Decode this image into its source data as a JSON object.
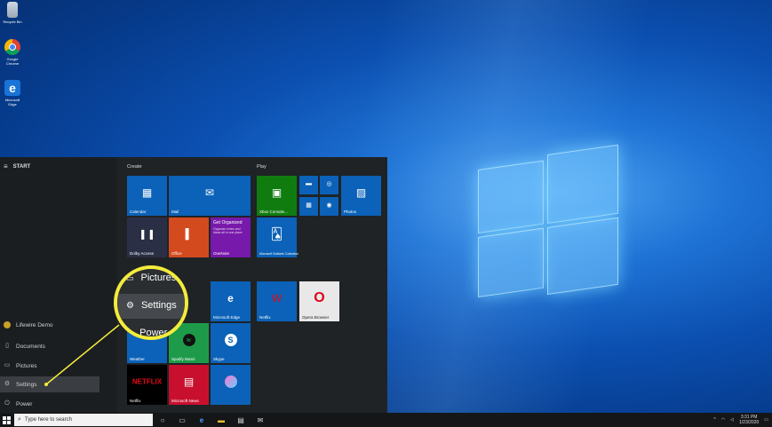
{
  "desktop": {
    "icons": [
      {
        "name": "Recycle Bin",
        "icon": "recycle-bin-icon"
      },
      {
        "name": "Google Chrome",
        "icon": "chrome-icon"
      },
      {
        "name": "Microsoft Edge",
        "icon": "edge-icon"
      }
    ]
  },
  "start_menu": {
    "header": "START",
    "rail_items": [
      "Lifewire Demo",
      "Documents",
      "Pictures",
      "Settings",
      "Power"
    ],
    "selected": "Settings",
    "group_create": "Create",
    "group_play": "Play",
    "tiles": {
      "calendar": "Calendar",
      "mail": "Mail",
      "dolby": "Dolby Access",
      "office": "Office",
      "onenote_title": "Get Organized",
      "onenote_body": "Organize notes and ideas all in one place",
      "onenote": "OneNote",
      "xbox": "Xbox Console...",
      "photos": "Photos",
      "solitaire": "Microsoft Solitaire Collection",
      "edge": "Microsoft Edge",
      "netflix_tile": "Netflix",
      "opera": "Opera Browser",
      "weather": "Weather",
      "spotify": "Spotify Music",
      "skype": "Skype",
      "netflix_logo": "NETFLIX",
      "netflix": "Netflix",
      "news": "Microsoft News",
      "paint": ""
    }
  },
  "magnifier": {
    "items": [
      "Pictures",
      "Settings",
      "Power"
    ],
    "selected": "Settings"
  },
  "taskbar": {
    "search_placeholder": "Type here to search",
    "time": "3:31 PM",
    "date": "1/23/2020"
  },
  "colors": {
    "accent_blue": "#0b62b8",
    "highlight_yellow": "#f4ec3b"
  }
}
